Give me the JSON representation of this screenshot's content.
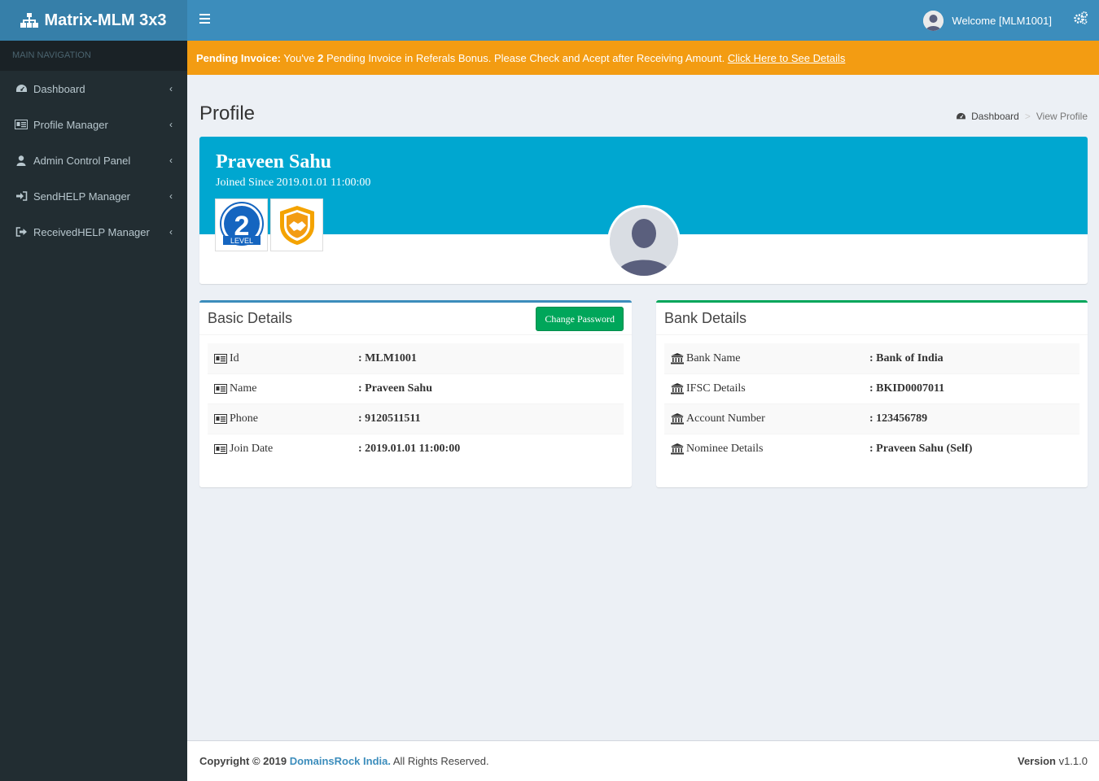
{
  "app": {
    "brand_title": "Matrix-MLM 3x3",
    "brand_color": "#367fa9",
    "header_color": "#3c8dbc",
    "sidebar_color": "#222d32"
  },
  "sidebar": {
    "header": "MAIN NAVIGATION",
    "items": [
      {
        "label": "Dashboard",
        "icon": "dashboard-icon"
      },
      {
        "label": "Profile Manager",
        "icon": "id-card-icon"
      },
      {
        "label": "Admin Control Panel",
        "icon": "user-icon"
      },
      {
        "label": "SendHELP Manager",
        "icon": "sign-in-icon"
      },
      {
        "label": "ReceivedHELP Manager",
        "icon": "sign-out-icon"
      }
    ]
  },
  "topbar": {
    "welcome": "Welcome [MLM1001]"
  },
  "alert": {
    "title": "Pending Invoice:",
    "msg_pre": " You've ",
    "count": "2",
    "msg_post": " Pending Invoice in Referals Bonus. Please Check and Acept after Receiving Amount. ",
    "link": "Click Here to See Details",
    "color": "#f39c12"
  },
  "page": {
    "title": "Profile",
    "breadcrumb": {
      "home": "Dashboard",
      "sep": ">",
      "current": "View Profile"
    }
  },
  "profile": {
    "name": "Praveen Sahu",
    "joined": "Joined Since 2019.01.01 11:00:00",
    "level_badge": {
      "number": "2",
      "text": "LEVEL"
    },
    "banner_color": "#00a7d0"
  },
  "basic_details": {
    "title": "Basic Details",
    "button": "Change Password",
    "rows": [
      {
        "key": "Id",
        "value": ": MLM1001"
      },
      {
        "key": "Name",
        "value": ": Praveen Sahu"
      },
      {
        "key": "Phone",
        "value": ": 9120511511"
      },
      {
        "key": "Join Date",
        "value": ": 2019.01.01 11:00:00"
      }
    ]
  },
  "bank_details": {
    "title": "Bank Details",
    "rows": [
      {
        "key": "Bank Name",
        "value": ": Bank of India"
      },
      {
        "key": "IFSC Details",
        "value": ": BKID0007011"
      },
      {
        "key": "Account Number",
        "value": ": 123456789"
      },
      {
        "key": "Nominee Details",
        "value": ": Praveen Sahu (Self)"
      }
    ]
  },
  "footer": {
    "copy_pre": "Copyright © 2019 ",
    "company": "DomainsRock India.",
    "copy_post": " All Rights Reserved.",
    "version_label": "Version",
    "version_value": " v1.1.0"
  }
}
